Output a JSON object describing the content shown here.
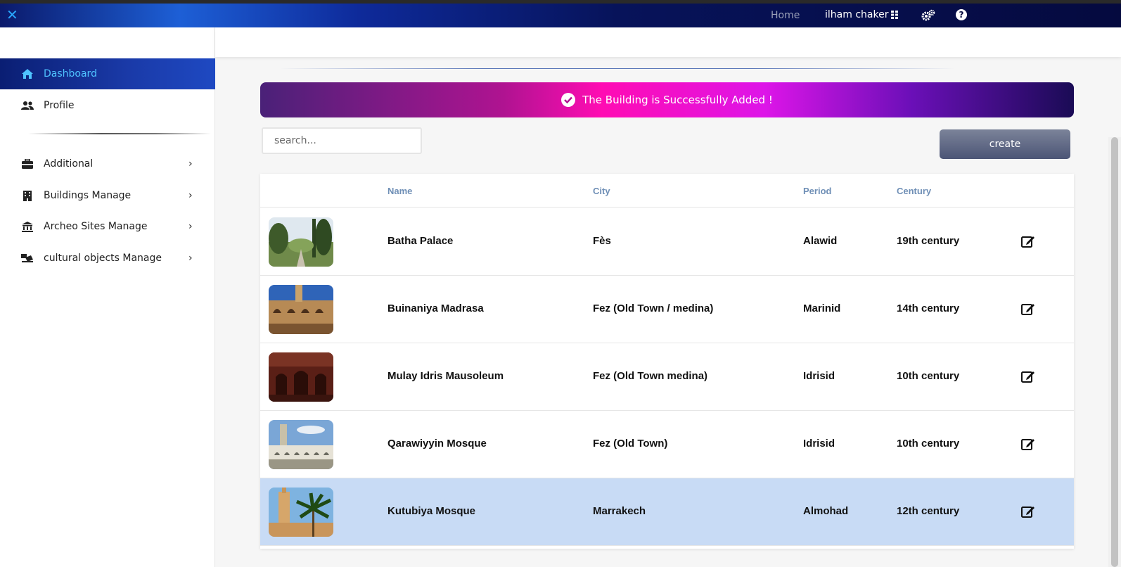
{
  "topbar": {
    "home_label": "Home",
    "user_name": "ilham chaker",
    "icons": [
      "close-icon",
      "grid-icon",
      "gears-icon",
      "help-icon"
    ]
  },
  "sidebar": {
    "items": [
      {
        "label": "Dashboard",
        "icon": "home-icon",
        "active": true
      },
      {
        "label": "Profile",
        "icon": "users-icon"
      },
      {
        "label": "Additional",
        "icon": "toolbox-icon",
        "chevron": true
      },
      {
        "label": "Buildings Manage",
        "icon": "building-icon",
        "chevron": true
      },
      {
        "label": "Archeo Sites Manage",
        "icon": "landmark-icon",
        "chevron": true
      },
      {
        "label": "cultural objects Manage",
        "icon": "artifact-icon",
        "chevron": true
      }
    ]
  },
  "alert": {
    "message": "The Building is Successfully Added !"
  },
  "search": {
    "placeholder": "search..."
  },
  "create": {
    "label": "create"
  },
  "table": {
    "columns": [
      "Name",
      "City",
      "Period",
      "Century"
    ],
    "rows": [
      {
        "name": "Batha Palace",
        "city": "Fès",
        "period": "Alawid",
        "century": "19th century"
      },
      {
        "name": "Buinaniya Madrasa",
        "city": "Fez (Old Town / medina)",
        "period": "Marinid",
        "century": "14th century"
      },
      {
        "name": "Mulay Idris Mausoleum",
        "city": "Fez (Old Town medina)",
        "period": "Idrisid",
        "century": "10th century"
      },
      {
        "name": "Qarawiyyin Mosque",
        "city": "Fez (Old Town)",
        "period": "Idrisid",
        "century": "10th century"
      },
      {
        "name": "Kutubiya Mosque",
        "city": "Marrakech",
        "period": "Almohad",
        "century": "12th century",
        "selected": true
      }
    ]
  },
  "colors": {
    "accent": "#4fc3ff",
    "header_text": "#6f8fb6",
    "selected_row": "#c8dbf5"
  }
}
